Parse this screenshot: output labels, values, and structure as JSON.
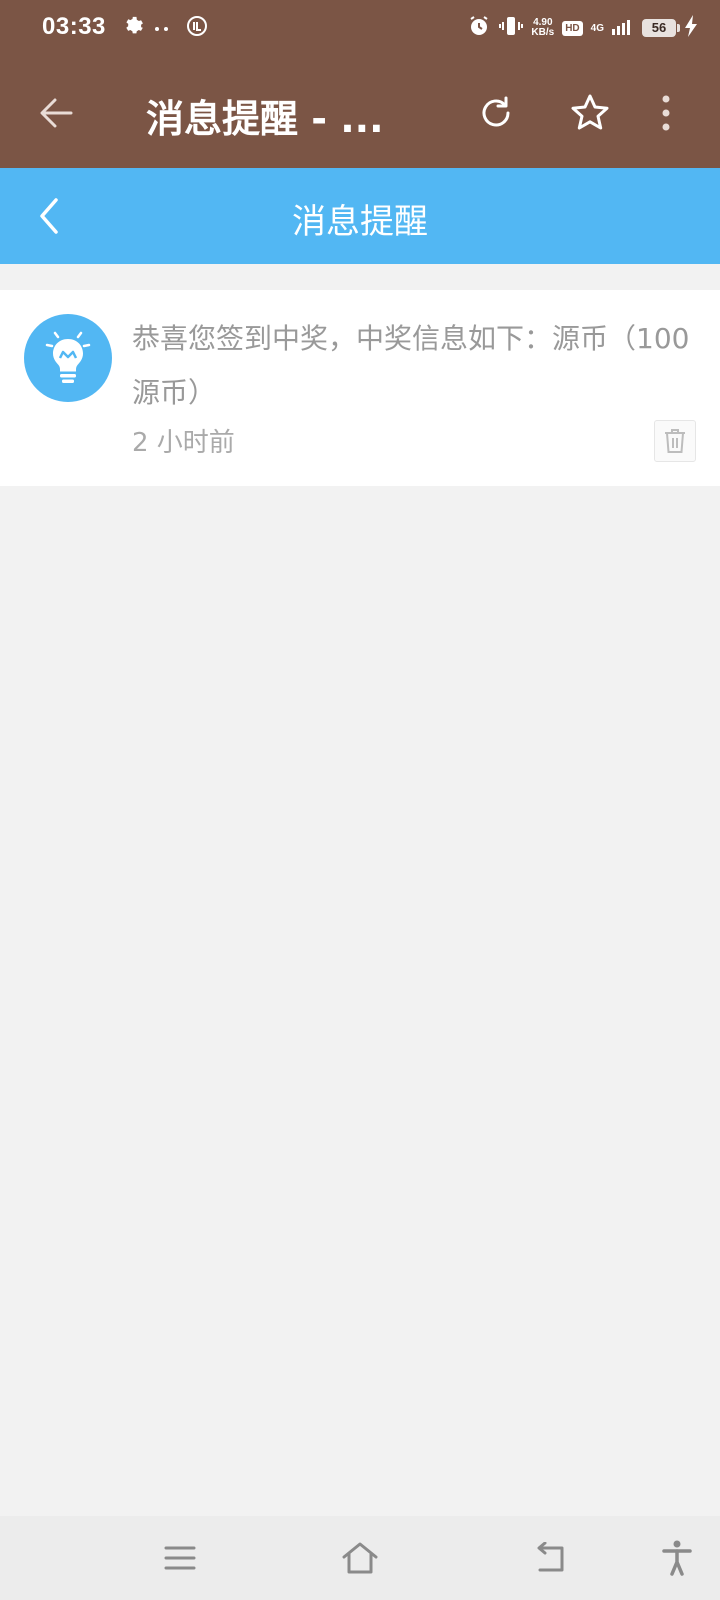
{
  "status_bar": {
    "time": "03:33",
    "net_speed_value": "4.90",
    "net_speed_unit": "KB/s",
    "hd": "HD",
    "network": "4G",
    "battery": "56"
  },
  "toolbar": {
    "title": "消息提醒 - ..."
  },
  "sub_header": {
    "title": "消息提醒"
  },
  "messages": [
    {
      "text": "恭喜您签到中奖，中奖信息如下：源币（100源币）",
      "time": "2 小时前"
    }
  ],
  "colors": {
    "toolbar_bg": "#7b5545",
    "header_bg": "#52b7f3",
    "page_bg": "#f2f2f2"
  }
}
